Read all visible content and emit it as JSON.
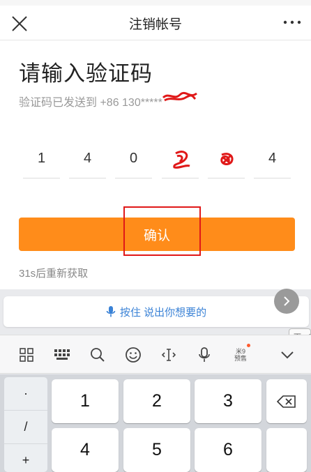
{
  "nav": {
    "title": "注销帐号",
    "close_icon": "close-icon",
    "more_icon": "more-icon"
  },
  "main": {
    "title": "请输入验证码",
    "subtitle": "验证码已发送到 +86 130*****",
    "code_digits": [
      "1",
      "4",
      "0",
      "",
      "",
      "4"
    ],
    "confirm_label": "确认",
    "resend_text": "31s后重新获取",
    "accent": "#ff8c1a",
    "annotation_color": "#e01818"
  },
  "ime": {
    "voice_label": "按住 说出你想要的",
    "next_tip": "下一项",
    "predict_top": "米9",
    "predict_bottom": "预售",
    "toolbar_icons": [
      "grid-icon",
      "keyboard-icon",
      "search-icon",
      "emoji-icon",
      "cursor-icon",
      "microphone-icon",
      "predict-icon",
      "chevron-down-icon"
    ],
    "symbol_keys": [
      "·",
      "/",
      "+"
    ],
    "keys": [
      "1",
      "2",
      "3",
      "4",
      "5",
      "6"
    ],
    "delete_icon": "backspace-icon",
    "voice_color": "#3a82d6"
  }
}
